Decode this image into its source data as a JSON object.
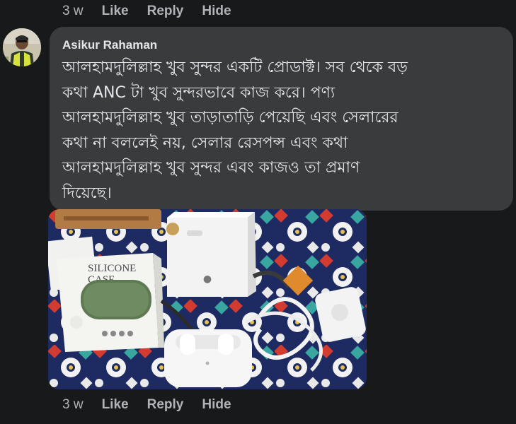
{
  "top_actions": {
    "time": "3 w",
    "like": "Like",
    "reply": "Reply",
    "hide": "Hide"
  },
  "comment": {
    "author": "Asikur Rahaman",
    "lines": [
      "আলহামদুলিল্লাহ খুব সুন্দর একটি প্রোডাক্ট। সব থেকে বড়",
      "কথা ANC টা খুব সুন্দরভাবে কাজ করে। পণ্য",
      "আলহামদুলিল্লাহ খুব তাড়াতাড়ি পেয়েছি এবং সেলারের",
      "কথা না বললেই নয়, সেলার রেসপন্স এবং কথা",
      "আলহামদুলিল্লাহ খুব সুন্দর এবং কাজও তা প্রমাণ",
      "দিয়েছে।"
    ]
  },
  "photo": {
    "case_label_line1": "SILICONE",
    "case_label_line2": "CASE",
    "apple_logo": "apple-logo-icon"
  },
  "bottom_actions": {
    "time": "3 w",
    "like": "Like",
    "reply": "Reply",
    "hide": "Hide"
  },
  "colors": {
    "background": "#18191a",
    "bubble": "#3a3b3c",
    "text_primary": "#e4e6eb",
    "text_secondary": "#b0b3b8"
  }
}
